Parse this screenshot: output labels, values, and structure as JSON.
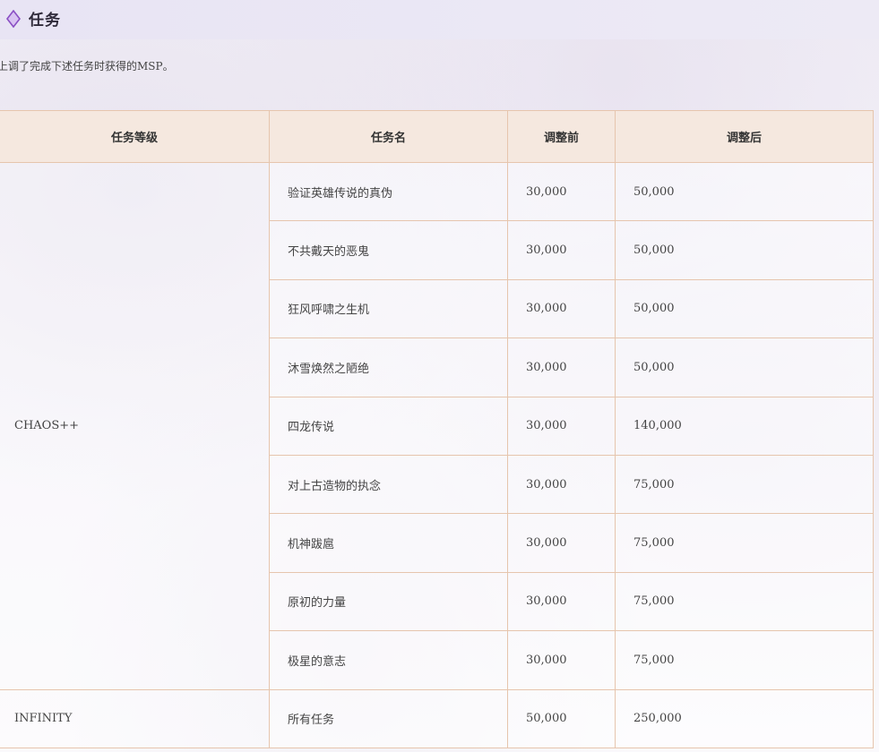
{
  "header": {
    "title": "任务",
    "icon": "diamond-icon",
    "accent_color": "#8a4fc4"
  },
  "intro": "上调了完成下述任务时获得的MSP。",
  "table": {
    "columns": [
      "任务等级",
      "任务名",
      "调整前",
      "调整后"
    ],
    "rows": [
      {
        "level": "CHAOS++",
        "name": "验证英雄传说的真伪",
        "before": "30,000",
        "after": "50,000"
      },
      {
        "level": "CHAOS++",
        "name": "不共戴天的恶鬼",
        "before": "30,000",
        "after": "50,000"
      },
      {
        "level": "CHAOS++",
        "name": "狂风呼啸之生机",
        "before": "30,000",
        "after": "50,000"
      },
      {
        "level": "CHAOS++",
        "name": "沐雪焕然之陋绝",
        "before": "30,000",
        "after": "50,000"
      },
      {
        "level": "CHAOS++",
        "name": "四龙传说",
        "before": "30,000",
        "after": "140,000"
      },
      {
        "level": "CHAOS++",
        "name": "对上古造物的执念",
        "before": "30,000",
        "after": "75,000"
      },
      {
        "level": "CHAOS++",
        "name": "机神跋扈",
        "before": "30,000",
        "after": "75,000"
      },
      {
        "level": "CHAOS++",
        "name": "原初的力量",
        "before": "30,000",
        "after": "75,000"
      },
      {
        "level": "CHAOS++",
        "name": "极星的意志",
        "before": "30,000",
        "after": "75,000"
      },
      {
        "level": "INFINITY",
        "name": "所有任务",
        "before": "50,000",
        "after": "250,000"
      }
    ]
  }
}
